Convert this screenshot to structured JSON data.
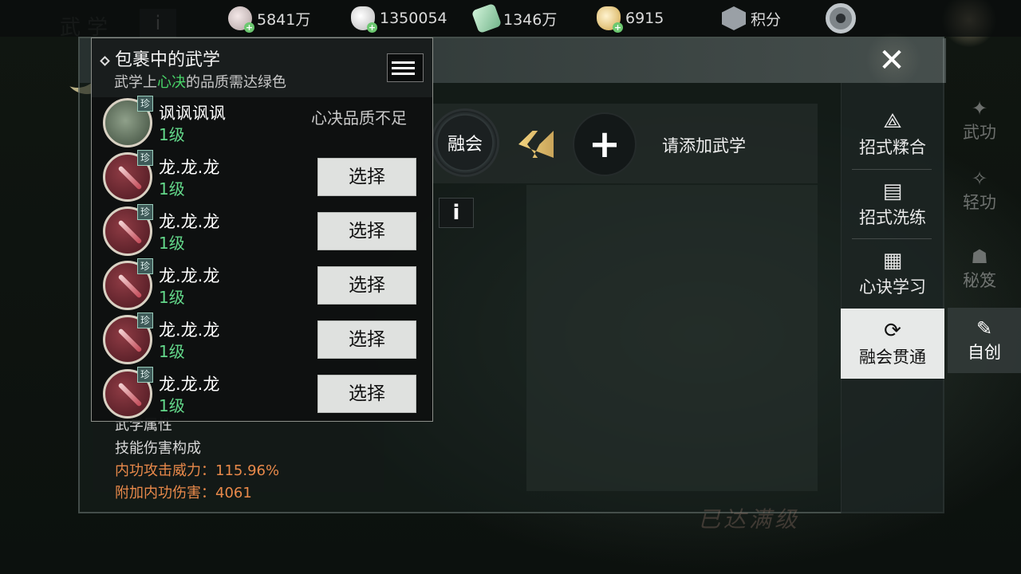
{
  "resources": [
    {
      "icon": "coin-icon",
      "value": "5841万"
    },
    {
      "icon": "silver-ingot-icon",
      "value": "1350054"
    },
    {
      "icon": "jade-icon",
      "value": "1346万"
    },
    {
      "icon": "gold-ingot-icon",
      "value": "6915"
    },
    {
      "icon": "badge-icon",
      "value": "积分"
    }
  ],
  "background": {
    "title": "武学",
    "info": "i",
    "watermark": "已达满级"
  },
  "popup": {
    "title": "包裹中的武学",
    "subtitle_prefix": "武学上",
    "subtitle_highlight": "心决",
    "subtitle_suffix": "的品质需达绿色",
    "items": [
      {
        "name": "讽讽讽讽",
        "level": "1级",
        "rare": "珍",
        "status": "心决品质不足",
        "button": ""
      },
      {
        "name": "龙.龙.龙",
        "level": "1级",
        "rare": "珍",
        "status": "",
        "button": "选择"
      },
      {
        "name": "龙.龙.龙",
        "level": "1级",
        "rare": "珍",
        "status": "",
        "button": "选择"
      },
      {
        "name": "龙.龙.龙",
        "level": "1级",
        "rare": "珍",
        "status": "",
        "button": "选择"
      },
      {
        "name": "龙.龙.龙",
        "level": "1级",
        "rare": "珍",
        "status": "",
        "button": "选择"
      },
      {
        "name": "龙.龙.龙",
        "level": "1级",
        "rare": "珍",
        "status": "",
        "button": "选择"
      }
    ]
  },
  "fusion": {
    "button": "融会",
    "add_label": "请添加武学",
    "info": "i"
  },
  "attributes": {
    "header": "武学属性",
    "line1": "技能伤害构成",
    "line2": "内功攻击威力：115.96%",
    "line3": "附加内功伤害：4061"
  },
  "side_tabs": [
    {
      "label": "招式糅合",
      "icon": "merge-icon"
    },
    {
      "label": "招式洗练",
      "icon": "scroll-icon"
    },
    {
      "label": "心诀学习",
      "icon": "book-icon"
    },
    {
      "label": "融会贯通",
      "icon": "cycle-icon",
      "active": true
    }
  ],
  "outer_tabs": [
    {
      "label": "武功"
    },
    {
      "label": "轻功"
    },
    {
      "label": "秘笈"
    },
    {
      "label": "自创",
      "active": true
    }
  ],
  "colors": {
    "green_text": "#48d468",
    "level_green": "#63d88a",
    "orange_text": "#e8894a"
  }
}
